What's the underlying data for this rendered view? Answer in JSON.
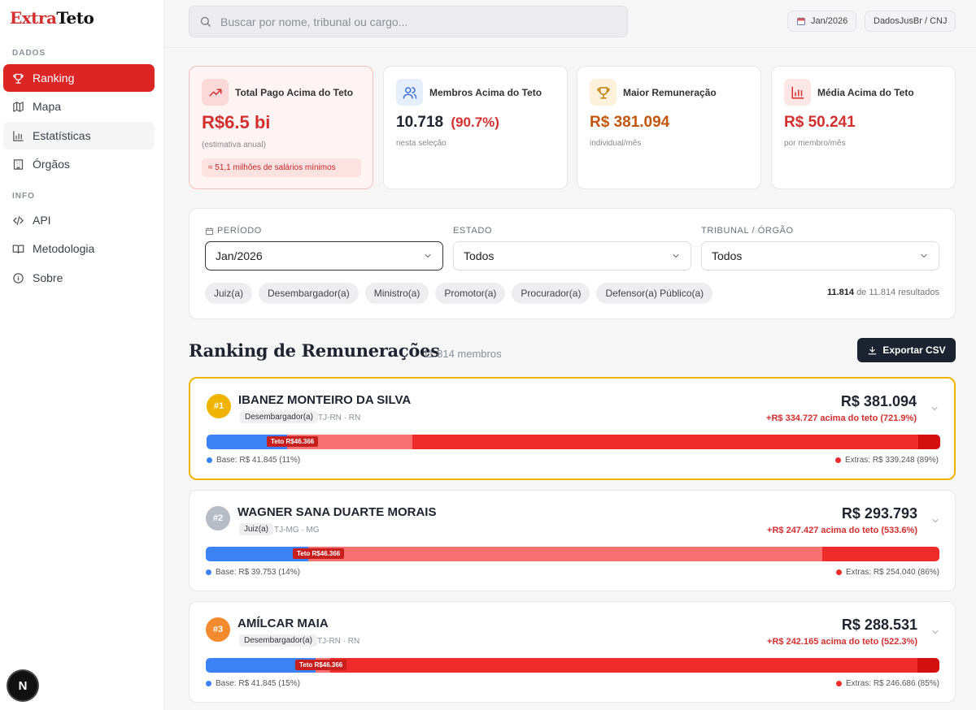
{
  "app": {
    "logo_part1": "Extra",
    "logo_part2": "Teto"
  },
  "sidebar": {
    "section_dados": "DADOS",
    "section_info": "INFO",
    "items": [
      {
        "label": "Ranking",
        "icon": "trophy-icon"
      },
      {
        "label": "Mapa",
        "icon": "map-icon"
      },
      {
        "label": "Estatísticas",
        "icon": "bar-chart-icon"
      },
      {
        "label": "Órgãos",
        "icon": "building-icon"
      },
      {
        "label": "API",
        "icon": "code-icon"
      },
      {
        "label": "Metodologia",
        "icon": "book-icon"
      },
      {
        "label": "Sobre",
        "icon": "info-icon"
      }
    ],
    "fab_label": "N"
  },
  "header": {
    "search_placeholder": "Buscar por nome, tribunal ou cargo...",
    "period_pill": "Jan/2026",
    "source_pill": "DadosJusBr / CNJ"
  },
  "stats": [
    {
      "title": "Total Pago Acima do Teto",
      "value": "R$6.5 bi",
      "sub": "(estimativa anual)",
      "note": "≈ 51,1 milhões de salários mínimos"
    },
    {
      "title": "Membros Acima do Teto",
      "value": "10.718",
      "value_pct": "(90.7%)",
      "sub": "nesta seleção"
    },
    {
      "title": "Maior Remuneração",
      "value": "R$ 381.094",
      "sub": "individual/mês"
    },
    {
      "title": "Média Acima do Teto",
      "value": "R$ 50.241",
      "sub": "por membro/mês"
    }
  ],
  "filters": {
    "period_label": "PERÍODO",
    "period_value": "Jan/2026",
    "state_label": "ESTADO",
    "state_value": "Todos",
    "court_label": "TRIBUNAL / ÓRGÃO",
    "court_value": "Todos",
    "chips": [
      "Juiz(a)",
      "Desembargador(a)",
      "Ministro(a)",
      "Promotor(a)",
      "Procurador(a)",
      "Defensor(a) Público(a)"
    ],
    "results_count": "11.814",
    "results_text": "de 11.814 resultados"
  },
  "ranking": {
    "title": "Ranking de Remunerações",
    "count": "11.814 membros",
    "export_label": "Exportar CSV",
    "members": [
      {
        "rank": "#1",
        "name": "IBANEZ MONTEIRO DA SILVA",
        "role": "Desembargador(a)",
        "location": "TJ-RN · RN",
        "total": "R$ 381.094",
        "over": "+R$ 334.727 acima do teto (721.9%)",
        "teto_label": "Teto R$46.366",
        "base_legend": "Base: R$ 41.845 (11%)",
        "extras_legend": "Extras: R$ 339.248 (89%)",
        "base_share": 0.11,
        "extras_share": 0.89,
        "segments": [
          0.11,
          0.17,
          0.69,
          0.03
        ]
      },
      {
        "rank": "#2",
        "name": "WAGNER SANA DUARTE MORAIS",
        "role": "Juiz(a)",
        "location": "TJ-MG · MG",
        "total": "R$ 293.793",
        "over": "+R$ 247.427 acima do teto (533.6%)",
        "teto_label": "Teto R$46.366",
        "base_legend": "Base: R$ 39.753 (14%)",
        "extras_legend": "Extras: R$ 254.040 (86%)",
        "base_share": 0.14,
        "extras_share": 0.86,
        "segments": [
          0.14,
          0.7,
          0.16,
          0.0
        ]
      },
      {
        "rank": "#3",
        "name": "AMÍLCAR MAIA",
        "role": "Desembargador(a)",
        "location": "TJ-RN · RN",
        "total": "R$ 288.531",
        "over": "+R$ 242.165 acima do teto (522.3%)",
        "teto_label": "Teto R$46.366",
        "base_legend": "Base: R$ 41.845 (15%)",
        "extras_legend": "Extras: R$ 246.686 (85%)",
        "base_share": 0.15,
        "extras_share": 0.85,
        "segments": [
          0.15,
          0.02,
          0.8,
          0.03
        ]
      }
    ]
  },
  "colors": {
    "accent": "#dc2626",
    "base_blue": "#3b82f6",
    "extra_light": "#f87171",
    "extra_red": "#ef2b2b",
    "extra_dark": "#d40f0f",
    "gold": "#f0b400",
    "silver": "#b8bcc4",
    "bronze": "#f38a2e"
  }
}
